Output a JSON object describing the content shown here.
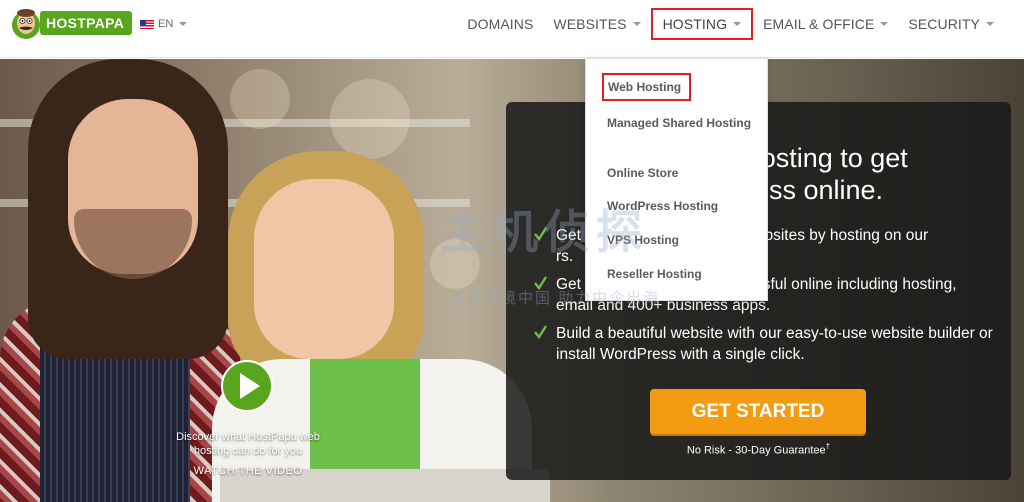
{
  "header": {
    "logo_text": "HOSTPAPA",
    "language": "EN",
    "nav": [
      {
        "label": "DOMAINS"
      },
      {
        "label": "WEBSITES"
      },
      {
        "label": "HOSTING"
      },
      {
        "label": "EMAIL & OFFICE"
      },
      {
        "label": "SECURITY"
      }
    ]
  },
  "dropdown": {
    "items": [
      {
        "label": "Web Hosting"
      },
      {
        "label": "Managed Shared Hosting"
      },
      {
        "label": "Online Store"
      },
      {
        "label": "WordPress Hosting"
      },
      {
        "label": "VPS Hosting"
      },
      {
        "label": "Reseller Hosting"
      }
    ]
  },
  "panel": {
    "headline": "F                hosting to get\n                ess online.",
    "features": [
      "Get                           n your websites by hosting on our                        rs.",
      "Get                            e successful online including hosting, email and 400+ business apps.",
      "Build a beautiful website with our easy-to-use website builder or install WordPress with a single click."
    ],
    "cta_label": "GET STARTED",
    "guarantee": "No Risk - 30-Day Guarantee",
    "guarantee_mark": "†"
  },
  "video": {
    "caption": "Discover what HostPapa web hosting can do for you",
    "watch_label": "WATCH THE VIDEO"
  },
  "watermark": {
    "main": "主机侦探",
    "sub": "服务跨境中国 助力中企出海"
  },
  "colors": {
    "brand_green": "#5aa51e",
    "cta_orange": "#f39c12",
    "highlight_red": "#e02020",
    "panel_bg": "#191919"
  },
  "icons": [
    "papa-mascot-icon",
    "us-flag-icon",
    "chevron-down-icon",
    "check-icon",
    "play-icon"
  ]
}
